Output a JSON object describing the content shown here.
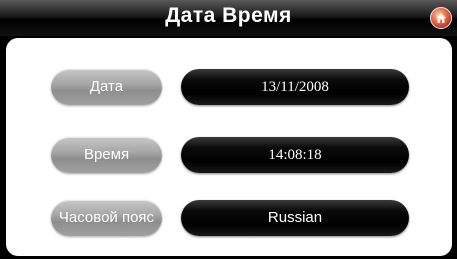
{
  "header": {
    "title": "Дата Время"
  },
  "home_icon": "home-icon",
  "rows": [
    {
      "label": "Дата",
      "value": "13/11/2008"
    },
    {
      "label": "Время",
      "value": "14:08:18"
    },
    {
      "label": "Часовой пояс",
      "value": "Russian"
    }
  ],
  "colors": {
    "background": "#000000",
    "panel": "#ffffff",
    "label_button": "#a8a8a8",
    "value_field": "#000000",
    "home_button": "#e05a3a"
  }
}
